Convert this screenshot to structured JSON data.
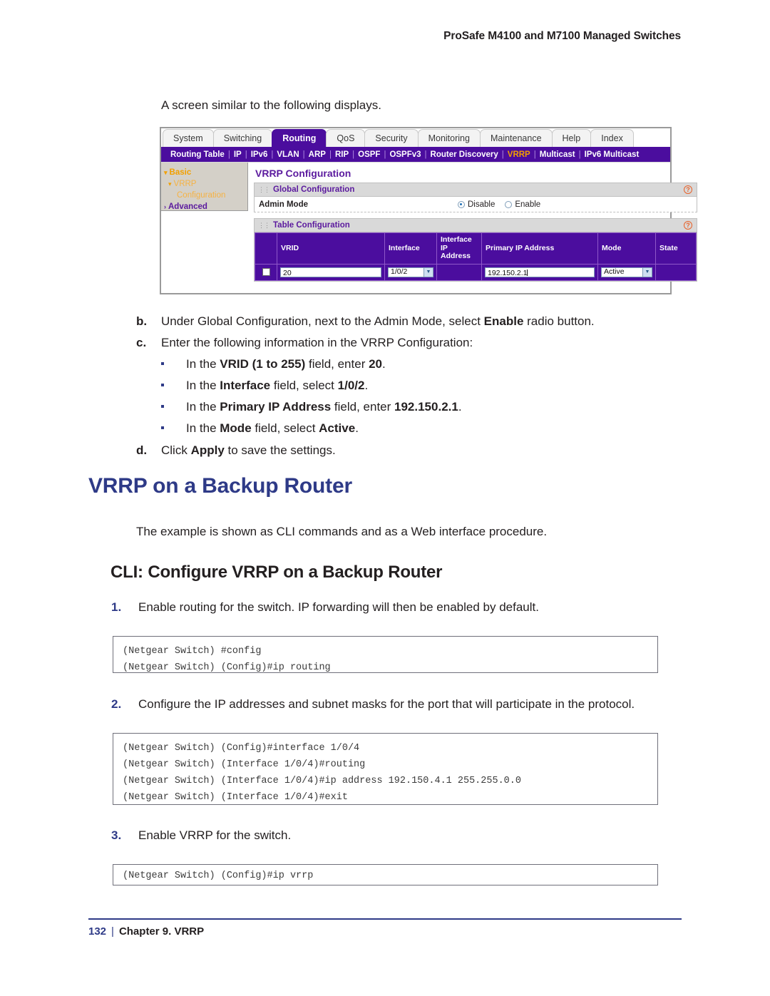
{
  "header": {
    "running_title": "ProSafe M4100 and M7100 Managed Switches"
  },
  "intro": {
    "line": "A screen similar to the following displays."
  },
  "screenshot": {
    "tabs": [
      {
        "label": "System",
        "active": false
      },
      {
        "label": "Switching",
        "active": false
      },
      {
        "label": "Routing",
        "active": true
      },
      {
        "label": "QoS",
        "active": false
      },
      {
        "label": "Security",
        "active": false
      },
      {
        "label": "Monitoring",
        "active": false
      },
      {
        "label": "Maintenance",
        "active": false
      },
      {
        "label": "Help",
        "active": false
      },
      {
        "label": "Index",
        "active": false
      }
    ],
    "submenu": [
      {
        "label": "Routing Table",
        "selected": false
      },
      {
        "label": "IP",
        "selected": false
      },
      {
        "label": "IPv6",
        "selected": false
      },
      {
        "label": "VLAN",
        "selected": false
      },
      {
        "label": "ARP",
        "selected": false
      },
      {
        "label": "RIP",
        "selected": false
      },
      {
        "label": "OSPF",
        "selected": false
      },
      {
        "label": "OSPFv3",
        "selected": false
      },
      {
        "label": "Router Discovery",
        "selected": false
      },
      {
        "label": "VRRP",
        "selected": true
      },
      {
        "label": "Multicast",
        "selected": false
      },
      {
        "label": "IPv6 Multicast",
        "selected": false
      }
    ],
    "nav": [
      {
        "label": "Basic",
        "level": 1,
        "style": "orange",
        "arrow": "▾"
      },
      {
        "label": "VRRP",
        "level": 2,
        "style": "orange-light",
        "arrow": "▾"
      },
      {
        "label": "Configuration",
        "level": 3,
        "style": "orange-light",
        "arrow": ""
      },
      {
        "label": "Advanced",
        "level": 1,
        "style": "purple",
        "arrow": "›"
      }
    ],
    "panel_title": "VRRP Configuration",
    "global_section": {
      "title": "Global Configuration",
      "help_glyph": "?",
      "row_label": "Admin Mode",
      "options": [
        {
          "label": "Disable",
          "selected": true
        },
        {
          "label": "Enable",
          "selected": false
        }
      ]
    },
    "table_section": {
      "title": "Table Configuration",
      "help_glyph": "?",
      "columns": [
        "",
        "VRID",
        "Interface",
        "Interface IP Address",
        "Primary IP Address",
        "Mode",
        "State"
      ],
      "row": {
        "checkbox": false,
        "vrid": "20",
        "interface": "1/0/2",
        "interface_ip_address": "",
        "primary_ip_address": "192.150.2.1",
        "mode": "Active",
        "state": ""
      }
    }
  },
  "steps": {
    "b": {
      "mark": "b.",
      "pre": "Under Global Configuration, next to the Admin Mode, select ",
      "bold": "Enable",
      "post": " radio button."
    },
    "c": {
      "mark": "c.",
      "text": "Enter the following information in the VRRP Configuration:"
    },
    "bullets": [
      {
        "pre": "In the ",
        "bold1": "VRID (1 to 255)",
        "mid": " field, enter ",
        "bold2": "20",
        "post": "."
      },
      {
        "pre": "In the ",
        "bold1": "Interface",
        "mid": " field, select ",
        "bold2": "1/0/2",
        "post": "."
      },
      {
        "pre": "In the ",
        "bold1": "Primary IP Address",
        "mid": " field, enter ",
        "bold2": "192.150.2.1",
        "post": "."
      },
      {
        "pre": "In the ",
        "bold1": "Mode",
        "mid": " field, select ",
        "bold2": "Active",
        "post": "."
      }
    ],
    "d": {
      "mark": "d.",
      "pre": "Click ",
      "bold": "Apply",
      "post": " to save the settings."
    }
  },
  "section": {
    "h1": "VRRP on a Backup Router",
    "intro_para": "The example is shown as CLI commands and as a Web interface procedure.",
    "h2": "CLI: Configure VRRP on a Backup Router"
  },
  "cli_steps": [
    {
      "mark": "1.",
      "text": "Enable routing for the switch. IP forwarding will then be enabled by default."
    },
    {
      "mark": "2.",
      "text": "Configure the IP addresses and subnet masks for the port that will participate in the protocol."
    },
    {
      "mark": "3.",
      "text": "Enable VRRP for the switch."
    }
  ],
  "code_blocks": [
    {
      "lines": [
        "(Netgear Switch) #config",
        "(Netgear Switch) (Config)#ip routing"
      ]
    },
    {
      "lines": [
        "(Netgear Switch) (Config)#interface 1/0/4",
        "(Netgear Switch) (Interface 1/0/4)#routing",
        "(Netgear Switch) (Interface 1/0/4)#ip address 192.150.4.1 255.255.0.0",
        "(Netgear Switch) (Interface 1/0/4)#exit"
      ]
    },
    {
      "lines": [
        "(Netgear Switch) (Config)#ip vrrp"
      ]
    }
  ],
  "footer": {
    "page_number": "132",
    "separator": "|",
    "chapter": "Chapter 9. VRRP"
  },
  "colors": {
    "accent_purple": "#4b0d9e",
    "heading_blue": "#2e3a87",
    "menu_highlight": "#f2a000"
  }
}
